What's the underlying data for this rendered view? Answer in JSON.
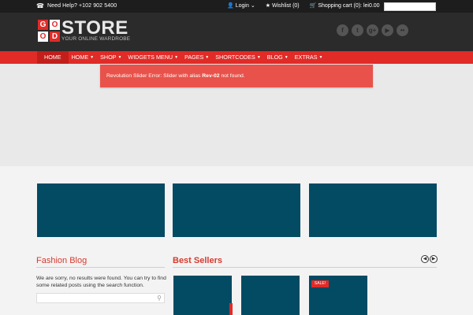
{
  "topbar": {
    "help_text": "Need Help? +102 902 5400",
    "login": "Login",
    "wishlist": "Wishlist (0)",
    "cart": "Shopping cart (0): lei0.00"
  },
  "header": {
    "logo_letters": [
      "G",
      "O",
      "O",
      "D"
    ],
    "logo_word": "STORE",
    "logo_tagline": "YOUR ONLINE WARDROBE",
    "social_icons": [
      "facebook-icon",
      "twitter-icon",
      "google-plus-icon",
      "youtube-icon",
      "flickr-icon"
    ]
  },
  "nav": {
    "items": [
      {
        "label": "HOME",
        "caret": false
      },
      {
        "label": "HOME",
        "caret": true
      },
      {
        "label": "SHOP",
        "caret": true
      },
      {
        "label": "WIDGETS MENU",
        "caret": true
      },
      {
        "label": "PAGES",
        "caret": true
      },
      {
        "label": "SHORTCODES",
        "caret": true
      },
      {
        "label": "BLOG",
        "caret": true
      },
      {
        "label": "EXTRAS",
        "caret": true
      }
    ]
  },
  "slider": {
    "error_prefix": "Revolution Slider Error: Slider with alias ",
    "error_alias": "Rev-02",
    "error_suffix": " not found."
  },
  "fashion_blog": {
    "title": "Fashion Blog",
    "empty_text": "We are sorry, no results were found. You can try to find some related posts using the search function."
  },
  "best_sellers": {
    "title": "Best Sellers",
    "sale_badge": "SALE!"
  },
  "colors": {
    "accent": "#e02b27",
    "banner": "#034a63",
    "header": "#2b2b2b",
    "topbar": "#1d1d1d"
  }
}
